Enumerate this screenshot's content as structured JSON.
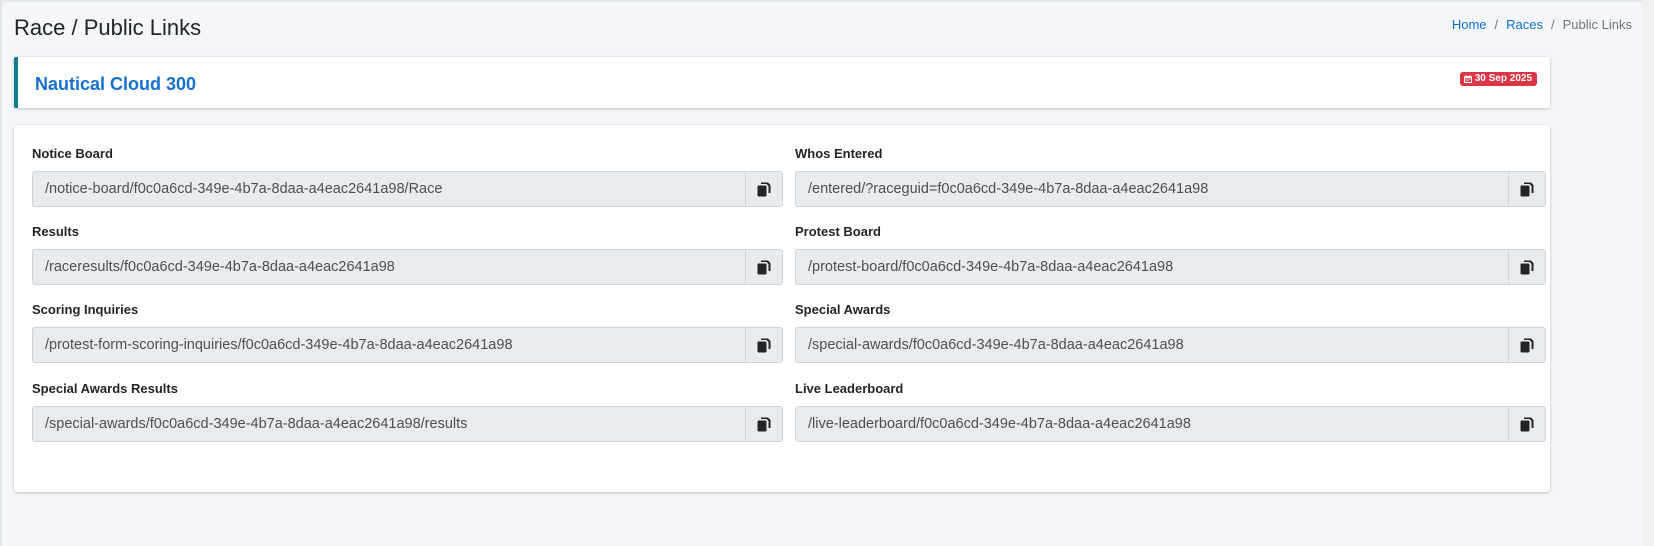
{
  "header": {
    "title": "Race / Public Links",
    "breadcrumb": {
      "home": "Home",
      "races": "Races",
      "current": "Public Links",
      "separator": "/"
    }
  },
  "race": {
    "name": "Nautical Cloud 300",
    "date_badge": "30 Sep 2025"
  },
  "links": {
    "notice_board": {
      "label": "Notice Board",
      "value": "/notice-board/f0c0a6cd-349e-4b7a-8daa-a4eac2641a98/Race"
    },
    "whos_entered": {
      "label": "Whos Entered",
      "value": "/entered/?raceguid=f0c0a6cd-349e-4b7a-8daa-a4eac2641a98"
    },
    "results": {
      "label": "Results",
      "value": "/raceresults/f0c0a6cd-349e-4b7a-8daa-a4eac2641a98"
    },
    "protest_board": {
      "label": "Protest Board",
      "value": "/protest-board/f0c0a6cd-349e-4b7a-8daa-a4eac2641a98"
    },
    "scoring_inquiries": {
      "label": "Scoring Inquiries",
      "value": "/protest-form-scoring-inquiries/f0c0a6cd-349e-4b7a-8daa-a4eac2641a98"
    },
    "special_awards": {
      "label": "Special Awards",
      "value": "/special-awards/f0c0a6cd-349e-4b7a-8daa-a4eac2641a98"
    },
    "special_awards_results": {
      "label": "Special Awards Results",
      "value": "/special-awards/f0c0a6cd-349e-4b7a-8daa-a4eac2641a98/results"
    },
    "live_leaderboard": {
      "label": "Live Leaderboard",
      "value": "/live-leaderboard/f0c0a6cd-349e-4b7a-8daa-a4eac2641a98"
    }
  },
  "icons": {
    "copy": "copy-icon",
    "calendar": "calendar-icon"
  },
  "colors": {
    "accent_link": "#1670d1",
    "callout_border": "#117a8b",
    "badge_danger": "#dc3545",
    "input_readonly_bg": "#e9ecef"
  }
}
